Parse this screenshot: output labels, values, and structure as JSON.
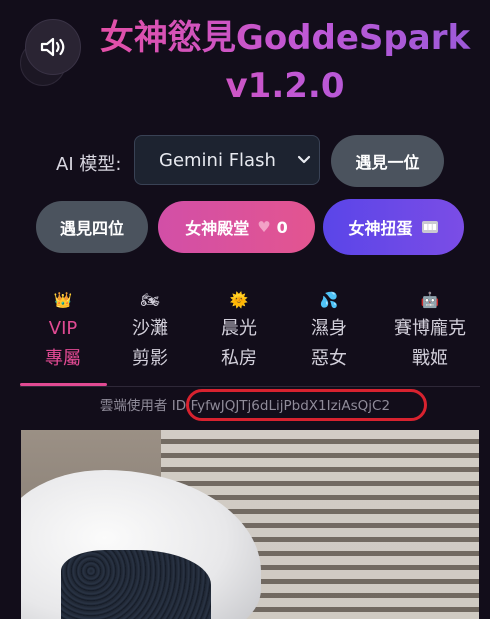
{
  "header": {
    "title_line1": "女神慾見GoddeSpark",
    "title_line2": "v1.2.0"
  },
  "model": {
    "label": "AI 模型:",
    "selected": "Gemini Flash"
  },
  "buttons": {
    "meet_one": "遇見一位",
    "meet_four": "遇見四位",
    "hall_label": "女神殿堂",
    "hall_count": "0",
    "gacha_label": "女神扭蛋"
  },
  "tabs": [
    {
      "emoji": "👑",
      "line1": "VIP",
      "line2": "專屬",
      "active": true
    },
    {
      "emoji": "🏍",
      "line1": "沙灘",
      "line2": "剪影",
      "active": false
    },
    {
      "emoji": "🌞",
      "line1": "晨光",
      "line2": "私房",
      "active": false
    },
    {
      "emoji": "💦",
      "line1": "濕身",
      "line2": "惡女",
      "active": false
    },
    {
      "emoji": "🤖",
      "line1": "賽博龐克",
      "line2": "戰姬",
      "active": false
    }
  ],
  "cloud_user": {
    "label": "雲端使用者 ID:",
    "id": "FyfwJQJTj6dLijPbdX1IziAsQjC2"
  },
  "colors": {
    "accent_pink": "#e14a93",
    "highlight_red": "#d8222f",
    "background": "#120d1a"
  }
}
